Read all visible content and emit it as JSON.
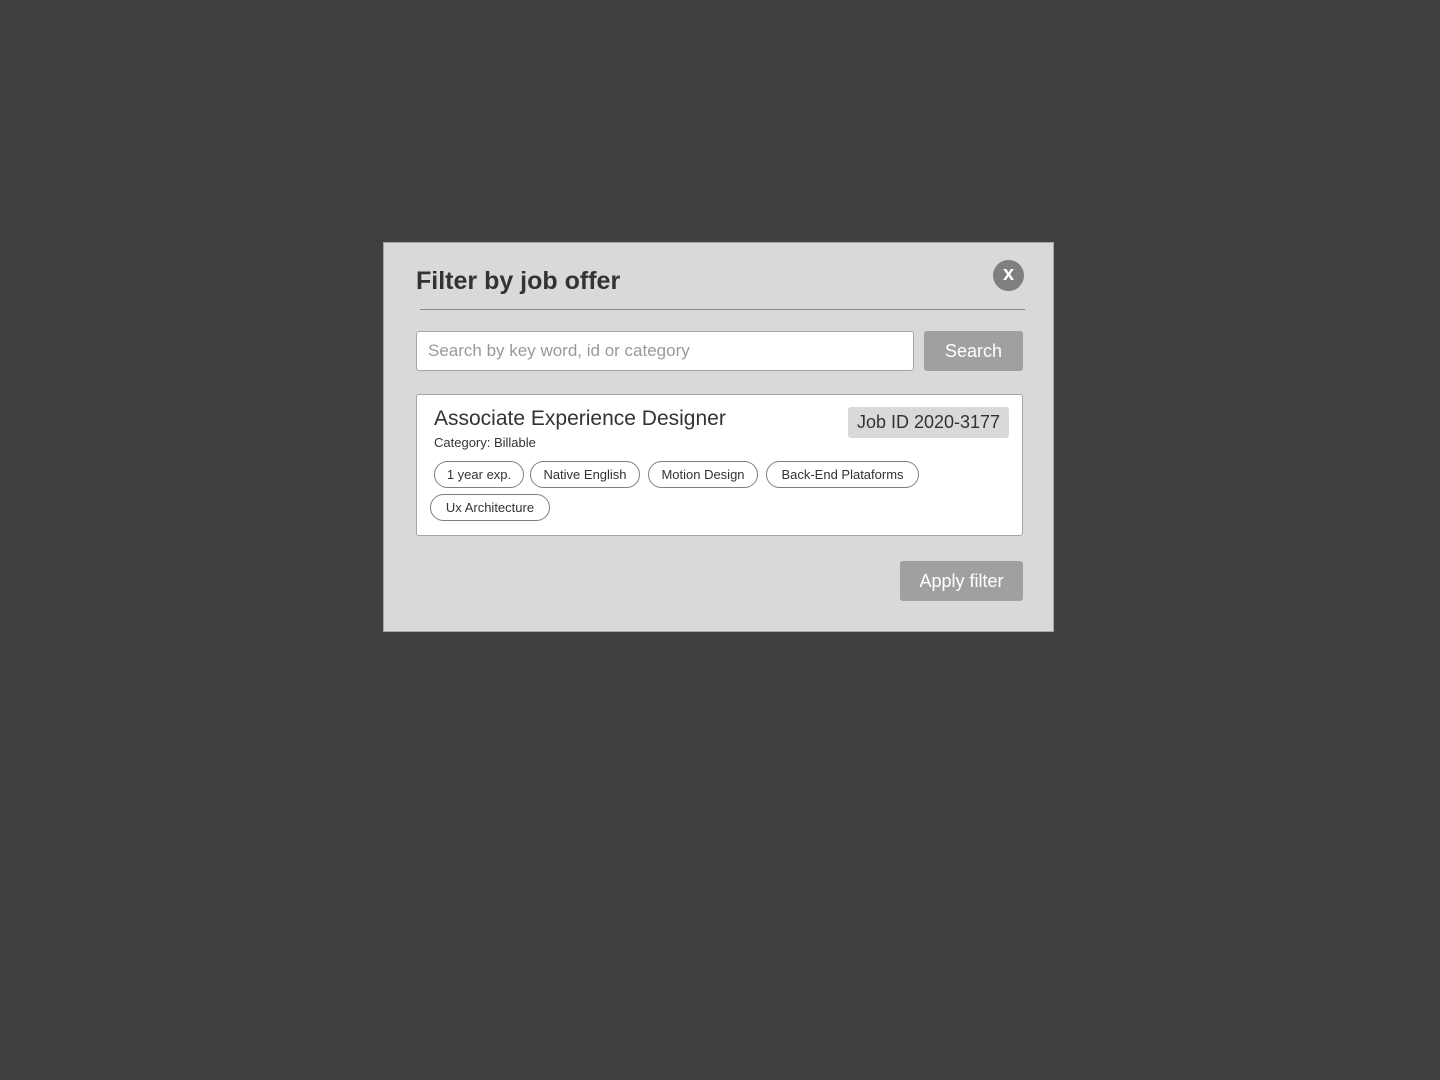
{
  "modal": {
    "title": "Filter by job offer",
    "close_label": "x"
  },
  "search": {
    "placeholder": "Search by key word, id or category",
    "value": "",
    "button_label": "Search"
  },
  "job": {
    "title": "Associate Experience Designer",
    "category": "Category: Billable",
    "job_id": "Job ID  2020-3177",
    "tags": [
      "1 year exp.",
      "Native English",
      "Motion Design",
      "Back-End Plataforms",
      "Ux Architecture"
    ]
  },
  "footer": {
    "apply_label": "Apply filter"
  },
  "colors": {
    "backdrop": "#404040",
    "modal_bg": "#d9d9d9",
    "button_bg": "#a0a0a0",
    "close_bg": "#7f7f7f"
  },
  "icons": {
    "close": "close-icon"
  }
}
